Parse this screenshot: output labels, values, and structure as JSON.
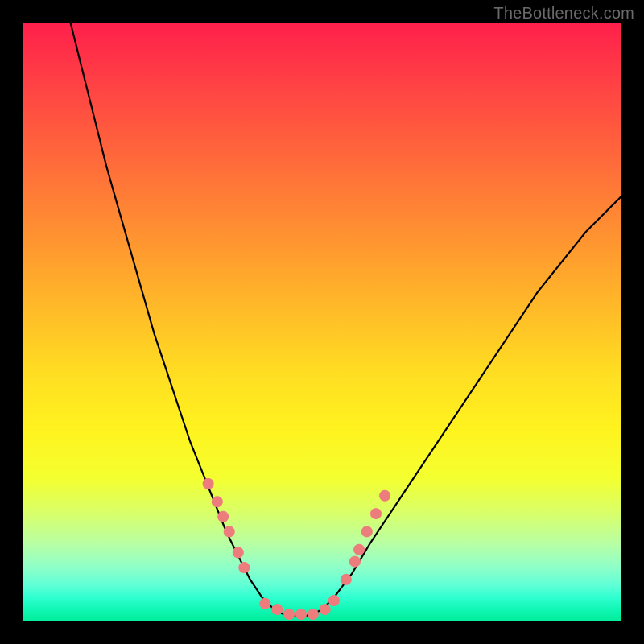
{
  "watermark": "TheBottleneck.com",
  "colors": {
    "frame": "#000000",
    "gradient_top": "#ff1f4b",
    "gradient_bottom": "#00ec9a",
    "curve": "#000000",
    "marker": "#ed7c7c"
  },
  "chart_data": {
    "type": "line",
    "title": "",
    "xlabel": "",
    "ylabel": "",
    "xlim": [
      0,
      100
    ],
    "ylim": [
      0,
      100
    ],
    "series": [
      {
        "name": "curve",
        "x": [
          8,
          10,
          12,
          14,
          16,
          18,
          20,
          22,
          24,
          26,
          28,
          30,
          32,
          34,
          36,
          38,
          40,
          42,
          44,
          46,
          48,
          50,
          52,
          55,
          58,
          62,
          66,
          70,
          74,
          78,
          82,
          86,
          90,
          94,
          98,
          100
        ],
        "y": [
          100,
          92,
          84,
          76,
          69,
          62,
          55,
          48,
          42,
          36,
          30,
          25,
          20,
          15,
          11,
          7,
          4,
          2,
          1,
          1,
          1,
          2,
          4,
          8,
          13,
          19,
          25,
          31,
          37,
          43,
          49,
          55,
          60,
          65,
          69,
          71
        ]
      }
    ],
    "markers": {
      "name": "dots",
      "x": [
        31,
        32.5,
        33.5,
        34.5,
        36,
        37,
        40.5,
        42.5,
        44.5,
        46.5,
        48.5,
        50.5,
        52,
        54,
        55.5,
        56.2,
        57.5,
        59,
        60.5
      ],
      "y": [
        23,
        20,
        17.5,
        15,
        11.5,
        9,
        3,
        2,
        1.2,
        1.2,
        1.2,
        2,
        3.5,
        7,
        10,
        12,
        15,
        18,
        21
      ]
    }
  }
}
